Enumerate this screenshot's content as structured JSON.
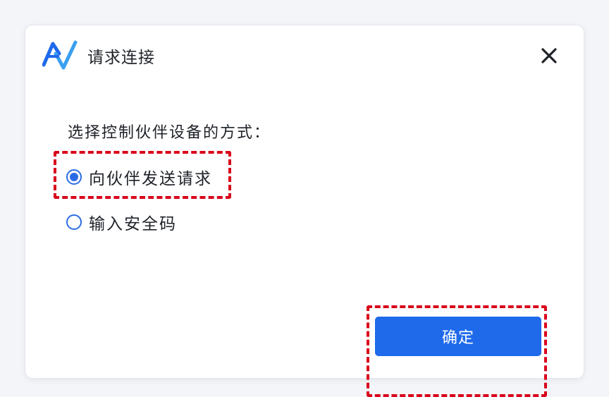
{
  "dialog": {
    "title": "请求连接",
    "close_icon": "close-icon",
    "logo_icon": "app-logo-icon",
    "prompt": "选择控制伙伴设备的方式：",
    "options": [
      {
        "label": "向伙伴发送请求",
        "selected": true
      },
      {
        "label": "输入安全码",
        "selected": false
      }
    ],
    "confirm_label": "确定"
  },
  "colors": {
    "accent": "#1f6aeb",
    "highlight": "#d9001b",
    "text": "#1f2329"
  }
}
